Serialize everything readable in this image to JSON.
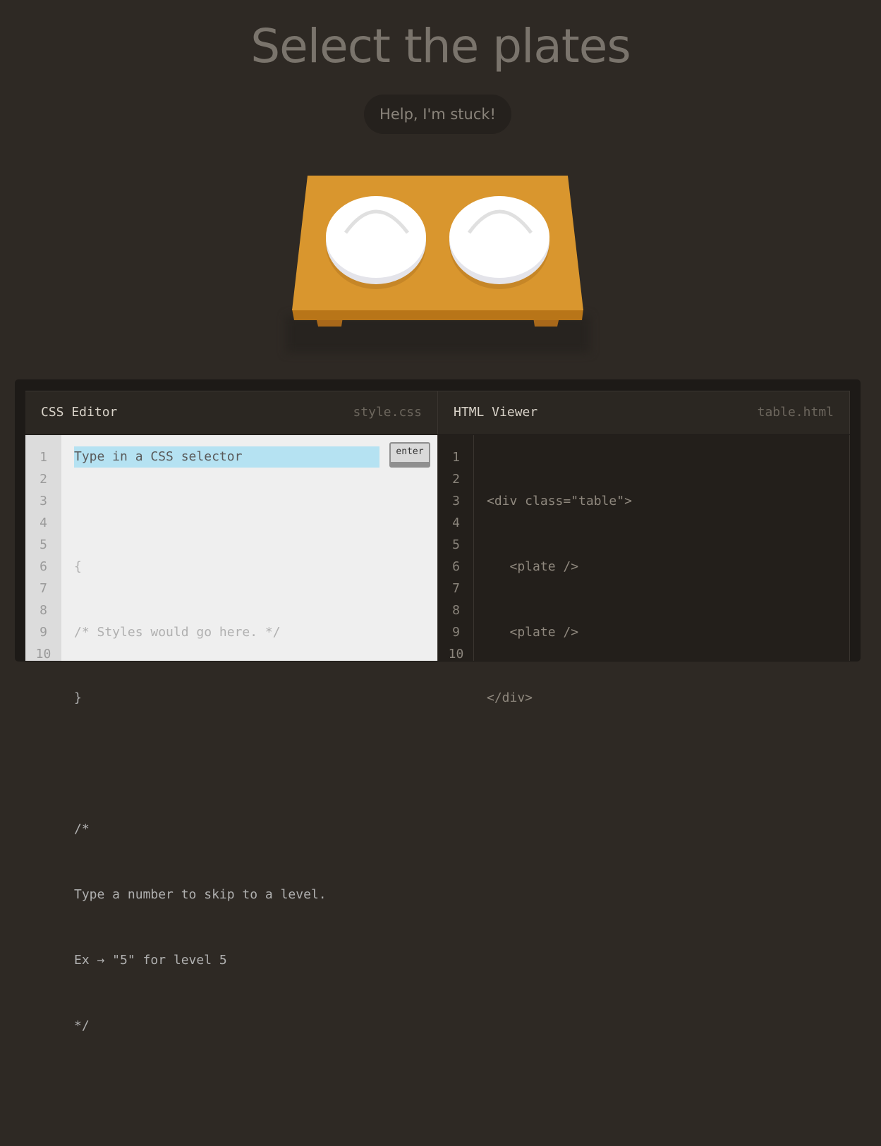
{
  "title": "Select the plates",
  "help_button": "Help, I'm stuck!",
  "css_editor": {
    "name": "CSS Editor",
    "file": "style.css",
    "input_placeholder": "Type in a CSS selector",
    "enter_label": "enter",
    "line_numbers": [
      "1",
      "2",
      "3",
      "4",
      "5",
      "6",
      "7",
      "8",
      "9",
      "10"
    ],
    "lines": [
      "",
      "{",
      "/* Styles would go here. */",
      "}",
      "",
      "/*",
      "Type a number to skip to a level.",
      "Ex → \"5\" for level 5",
      "*/",
      ""
    ]
  },
  "html_viewer": {
    "name": "HTML Viewer",
    "file": "table.html",
    "line_numbers": [
      "1",
      "2",
      "3",
      "4",
      "5",
      "6",
      "7",
      "8",
      "9",
      "10"
    ],
    "lines": [
      "<div class=\"table\">",
      "   <plate />",
      "   <plate />",
      "</div>",
      "",
      "",
      "",
      "",
      "",
      ""
    ]
  },
  "colors": {
    "background": "#2e2924",
    "table": "#d9962e",
    "plate": "#ffffff",
    "input_highlight": "#b5e2f2"
  }
}
